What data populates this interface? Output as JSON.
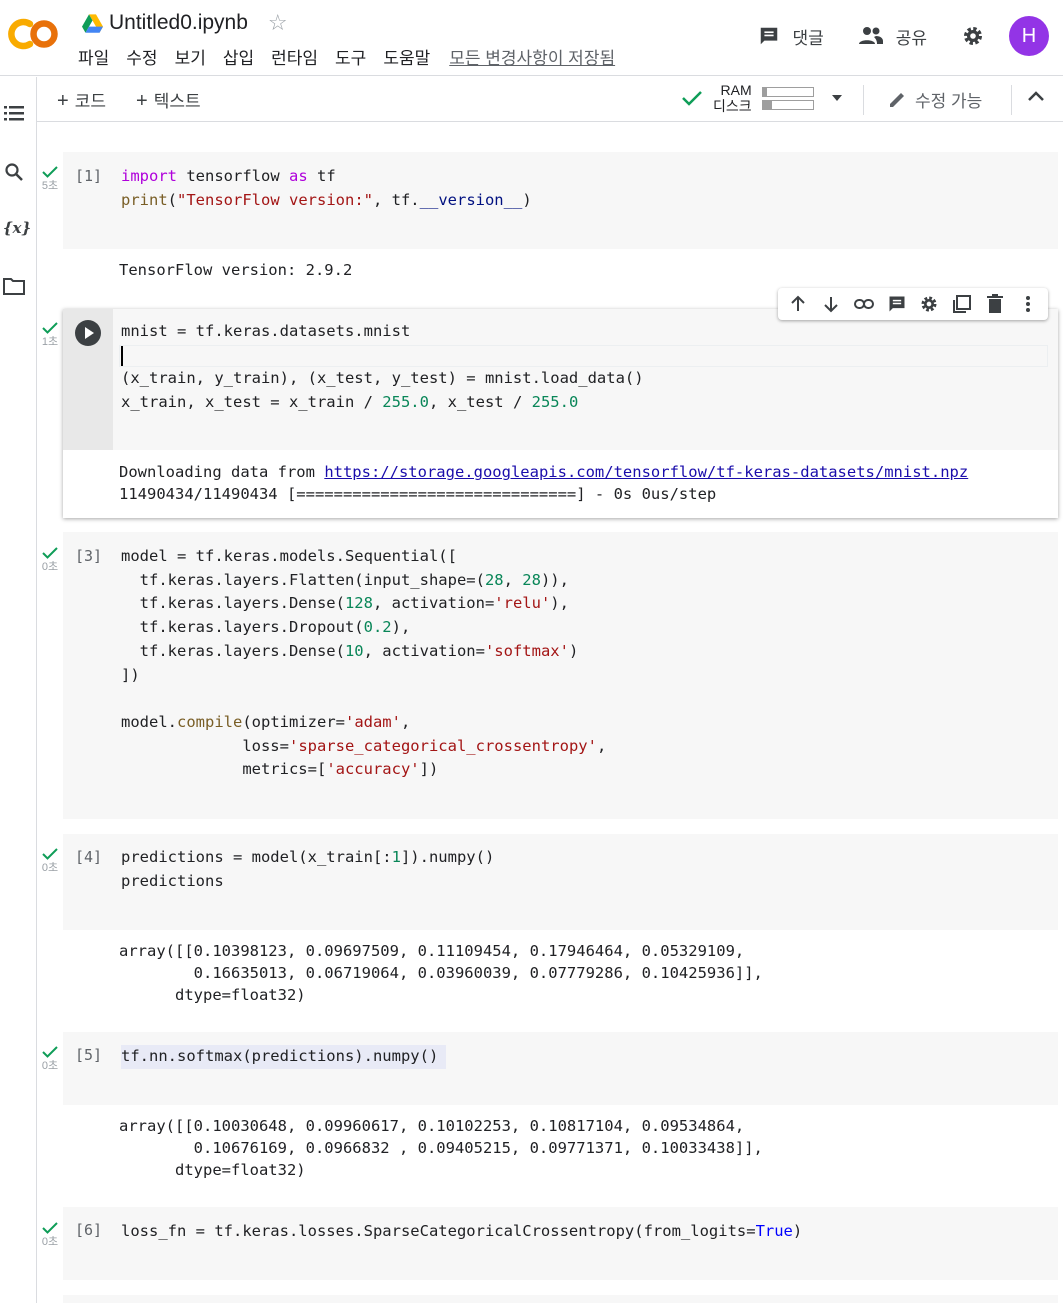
{
  "header": {
    "logo_text": "CO",
    "title": "Untitled0.ipynb",
    "menu": [
      "파일",
      "수정",
      "보기",
      "삽입",
      "런타임",
      "도구",
      "도움말"
    ],
    "save_status": "모든 변경사항이 저장됨",
    "comment_label": "댓글",
    "share_label": "공유",
    "avatar_letter": "H",
    "avatar_color": "#9334e6"
  },
  "toolbar": {
    "add_code": "코드",
    "add_text": "텍스트",
    "ram_label": "RAM",
    "disk_label": "디스크",
    "ram_usage": 0.08,
    "disk_usage": 0.18,
    "edit_mode": "수정 가능"
  },
  "cells": [
    {
      "count": "[1]",
      "time": "5초",
      "code": [
        "import tensorflow as tf",
        "print(\"TensorFlow version:\", tf.__version__)"
      ],
      "output": [
        "TensorFlow version: 2.9.2"
      ]
    },
    {
      "count": "",
      "time": "1초",
      "code": [
        "mnist = tf.keras.datasets.mnist",
        "",
        "(x_train, y_train), (x_test, y_test) = mnist.load_data()",
        "x_train, x_test = x_train / 255.0, x_test / 255.0"
      ],
      "output_prefix": "Downloading data from ",
      "output_link": "https://storage.googleapis.com/tensorflow/tf-keras-datasets/mnist.npz",
      "output_line2": "11490434/11490434 [==============================] - 0s 0us/step"
    },
    {
      "count": "[3]",
      "time": "0초",
      "code": [
        "model = tf.keras.models.Sequential([",
        "  tf.keras.layers.Flatten(input_shape=(28, 28)),",
        "  tf.keras.layers.Dense(128, activation='relu'),",
        "  tf.keras.layers.Dropout(0.2),",
        "  tf.keras.layers.Dense(10, activation='softmax')",
        "])",
        "",
        "model.compile(optimizer='adam',",
        "             loss='sparse_categorical_crossentropy',",
        "             metrics=['accuracy'])"
      ]
    },
    {
      "count": "[4]",
      "time": "0초",
      "code": [
        "predictions = model(x_train[:1]).numpy()",
        "predictions"
      ],
      "output": [
        "array([[0.10398123, 0.09697509, 0.11109454, 0.17946464, 0.05329109,",
        "        0.16635013, 0.06719064, 0.03960039, 0.07779286, 0.10425936]],",
        "      dtype=float32)"
      ]
    },
    {
      "count": "[5]",
      "time": "0초",
      "code": [
        "tf.nn.softmax(predictions).numpy()"
      ],
      "output": [
        "array([[0.10030648, 0.09960617, 0.10102253, 0.10817104, 0.09534864,",
        "        0.10676169, 0.0966832 , 0.09405215, 0.09771371, 0.10033438]],",
        "      dtype=float32)"
      ]
    },
    {
      "count": "[6]",
      "time": "0초",
      "code": [
        "loss_fn = tf.keras.losses.SparseCategoricalCrossentropy(from_logits=True)"
      ]
    }
  ],
  "colors": {
    "check": "#0f9d58",
    "keyword": "#af00db",
    "string": "#a31515",
    "number": "#098658",
    "link": "#1a0dab"
  }
}
